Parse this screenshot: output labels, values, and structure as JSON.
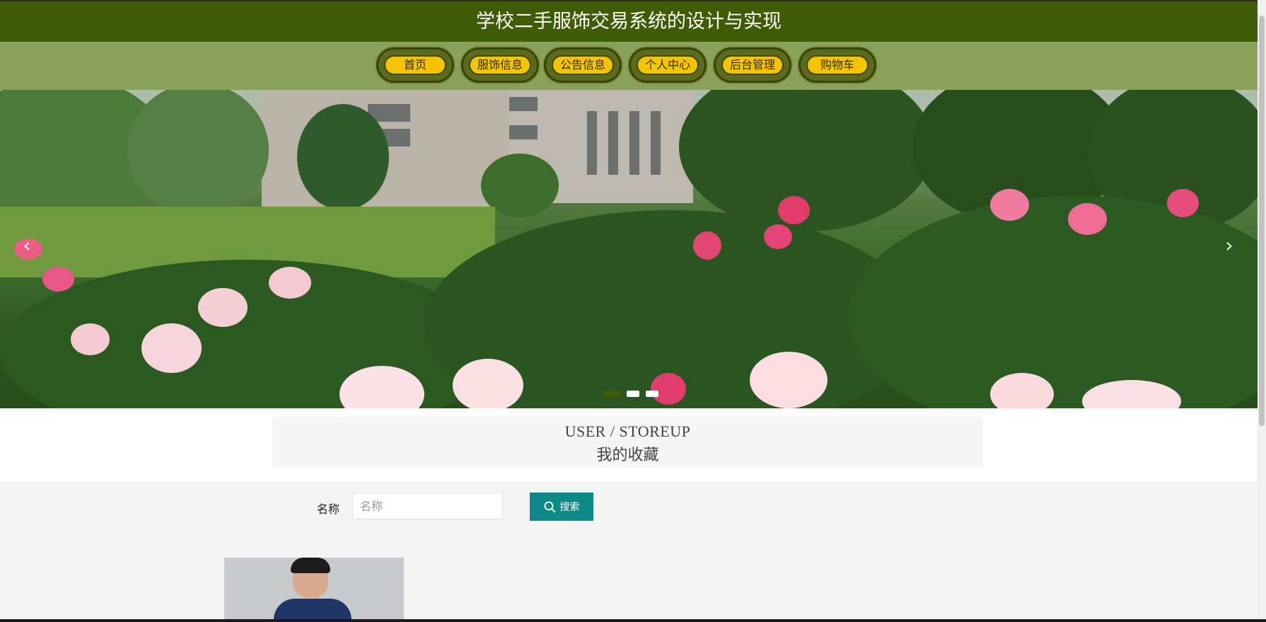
{
  "header": {
    "title": "学校二手服饰交易系统的设计与实现"
  },
  "nav": {
    "items": [
      {
        "label": "首页"
      },
      {
        "label": "服饰信息"
      },
      {
        "label": "公告信息"
      },
      {
        "label": "个人中心"
      },
      {
        "label": "后台管理"
      },
      {
        "label": "购物车"
      }
    ]
  },
  "carousel": {
    "prev_icon": "chevron-left-icon",
    "next_icon": "chevron-right-icon",
    "slides": 3,
    "active_index": 0
  },
  "section": {
    "title_en": "USER / STOREUP",
    "title_cn": "我的收藏"
  },
  "search": {
    "label": "名称",
    "placeholder": "名称",
    "value": "",
    "button_label": "搜索",
    "button_icon": "search-icon"
  },
  "colors": {
    "header": "#3f5b06",
    "nav_bg": "#8aa159",
    "nav_pill": "#f4c400",
    "search_button": "#0d8a87"
  }
}
